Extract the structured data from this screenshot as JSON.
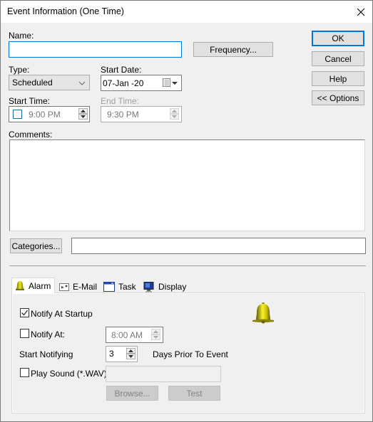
{
  "window": {
    "title": "Event Information (One Time)",
    "close_icon": "close-icon"
  },
  "form": {
    "name_label": "Name:",
    "name_value": "",
    "frequency_button": "Frequency...",
    "type_label": "Type:",
    "type_value": "Scheduled",
    "start_date_label": "Start Date:",
    "start_date_value": "07-Jan -20",
    "start_time_label": "Start Time:",
    "start_time_checked": false,
    "start_time_value": "9:00 PM",
    "end_time_label": "End Time:",
    "end_time_value": "9:30 PM",
    "comments_label": "Comments:",
    "comments_value": "",
    "categories_button": "Categories...",
    "categories_value": ""
  },
  "buttons": {
    "ok": "OK",
    "cancel": "Cancel",
    "help": "Help",
    "options": "<< Options"
  },
  "tabs": [
    {
      "label": "Alarm",
      "icon": "bell-icon",
      "active": true
    },
    {
      "label": "E-Mail",
      "icon": "email-icon",
      "active": false
    },
    {
      "label": "Task",
      "icon": "task-window-icon",
      "active": false
    },
    {
      "label": "Display",
      "icon": "monitor-icon",
      "active": false
    }
  ],
  "alarm": {
    "notify_startup_label": "Notify At Startup",
    "notify_startup_checked": true,
    "notify_at_label": "Notify At:",
    "notify_at_checked": false,
    "notify_at_value": "8:00 AM",
    "start_notifying_label": "Start Notifying",
    "days_value": "3",
    "days_suffix": "Days Prior To Event",
    "play_sound_label": "Play Sound (*.WAV):",
    "play_sound_checked": false,
    "sound_file_value": "",
    "browse_button": "Browse...",
    "test_button": "Test"
  },
  "colors": {
    "accent": "#0078d7",
    "bell": "#c8c000"
  }
}
